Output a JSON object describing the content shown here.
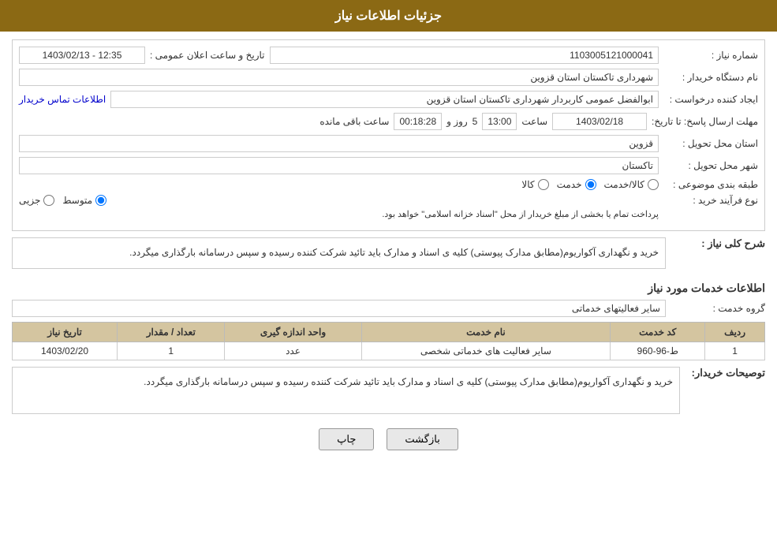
{
  "header": {
    "title": "جزئیات اطلاعات نیاز"
  },
  "fields": {
    "need_number_label": "شماره نیاز :",
    "need_number_value": "1103005121000041",
    "buyer_org_label": "نام دستگاه خریدار :",
    "buyer_org_value": "شهرداری تاکستان استان قزوین",
    "creator_label": "ایجاد کننده درخواست :",
    "creator_value": "ابوالفضل عمومی کاربردار شهرداری تاکستان استان قزوین",
    "contact_link": "اطلاعات تماس خریدار",
    "response_deadline_label": "مهلت ارسال پاسخ: تا تاریخ:",
    "response_date_value": "1403/02/18",
    "response_time_label": "ساعت",
    "response_time_value": "13:00",
    "response_days_label": "روز و",
    "response_days_value": "5",
    "response_remaining_label": "ساعت باقی مانده",
    "response_remaining_value": "00:18:28",
    "announce_label": "تاریخ و ساعت اعلان عمومی :",
    "announce_value": "1403/02/13 - 12:35",
    "delivery_province_label": "استان محل تحویل :",
    "delivery_province_value": "قزوین",
    "delivery_city_label": "شهر محل تحویل :",
    "delivery_city_value": "تاکستان",
    "category_label": "طبقه بندی موضوعی :",
    "category_options": [
      "کالا",
      "خدمت",
      "کالا/خدمت"
    ],
    "category_selected": "خدمت",
    "purchase_type_label": "نوع فرآیند خرید :",
    "purchase_type_options": [
      "جزیی",
      "متوسط"
    ],
    "purchase_type_note": "پرداخت تمام یا بخشی از مبلغ خریدار از محل \"اسناد خزانه اسلامی\" خواهد بود.",
    "description_title": "شرح کلی نیاز :",
    "description_text": "خرید و نگهداری آکواریوم(مطابق مدارک پیوستی) کلیه ی اسناد و مدارک باید تائید شرکت کننده رسیده و سپس درسامانه بارگذاری میگردد.",
    "services_title": "اطلاعات خدمات مورد نیاز",
    "service_group_label": "گروه خدمت :",
    "service_group_value": "سایر فعالیتهای خدماتی",
    "table": {
      "headers": [
        "ردیف",
        "کد خدمت",
        "نام خدمت",
        "واحد اندازه گیری",
        "تعداد / مقدار",
        "تاریخ نیاز"
      ],
      "rows": [
        {
          "row": "1",
          "code": "ط-96-960",
          "name": "سایر فعالیت های خدماتی شخصی",
          "unit": "عدد",
          "quantity": "1",
          "date": "1403/02/20"
        }
      ]
    },
    "buyer_desc_label": "توصیحات خریدار:",
    "buyer_desc_value": "خرید و نگهداری آکواریوم(مطابق مدارک پیوستی) کلیه ی اسناد و مدارک باید تائید شرکت کننده رسیده و سپس درسامانه بارگذاری میگردد."
  },
  "buttons": {
    "back": "بازگشت",
    "print": "چاپ"
  }
}
